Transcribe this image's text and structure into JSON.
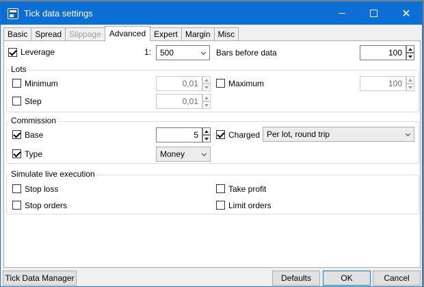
{
  "window": {
    "title": "Tick data settings"
  },
  "tabs": [
    {
      "label": "Basic"
    },
    {
      "label": "Spread"
    },
    {
      "label": "Slippage"
    },
    {
      "label": "Advanced"
    },
    {
      "label": "Expert"
    },
    {
      "label": "Margin"
    },
    {
      "label": "Misc"
    }
  ],
  "leverage": {
    "label": "Leverage",
    "checked": true,
    "prefix": "1:",
    "value": "500"
  },
  "bars_before_data": {
    "label": "Bars before data",
    "value": "100"
  },
  "lots": {
    "title": "Lots",
    "minimum": {
      "label": "Minimum",
      "value": "0,01"
    },
    "maximum": {
      "label": "Maximum",
      "value": "100"
    },
    "step": {
      "label": "Step",
      "value": "0,01"
    }
  },
  "commission": {
    "title": "Commission",
    "base": {
      "label": "Base",
      "value": "5"
    },
    "charged": {
      "label": "Charged",
      "value": "Per lot, round trip"
    },
    "type": {
      "label": "Type",
      "value": "Money"
    }
  },
  "simulate": {
    "title": "Simulate live execution",
    "stop_loss": "Stop loss",
    "take_profit": "Take profit",
    "stop_orders": "Stop orders",
    "limit_orders": "Limit orders"
  },
  "buttons": {
    "tick_data_manager": "Tick Data Manager",
    "defaults": "Defaults",
    "ok": "OK",
    "cancel": "Cancel"
  },
  "colors": {
    "titlebar": "#0b6fd6",
    "panel": "#ffffff",
    "dialog": "#f0f0f0"
  }
}
